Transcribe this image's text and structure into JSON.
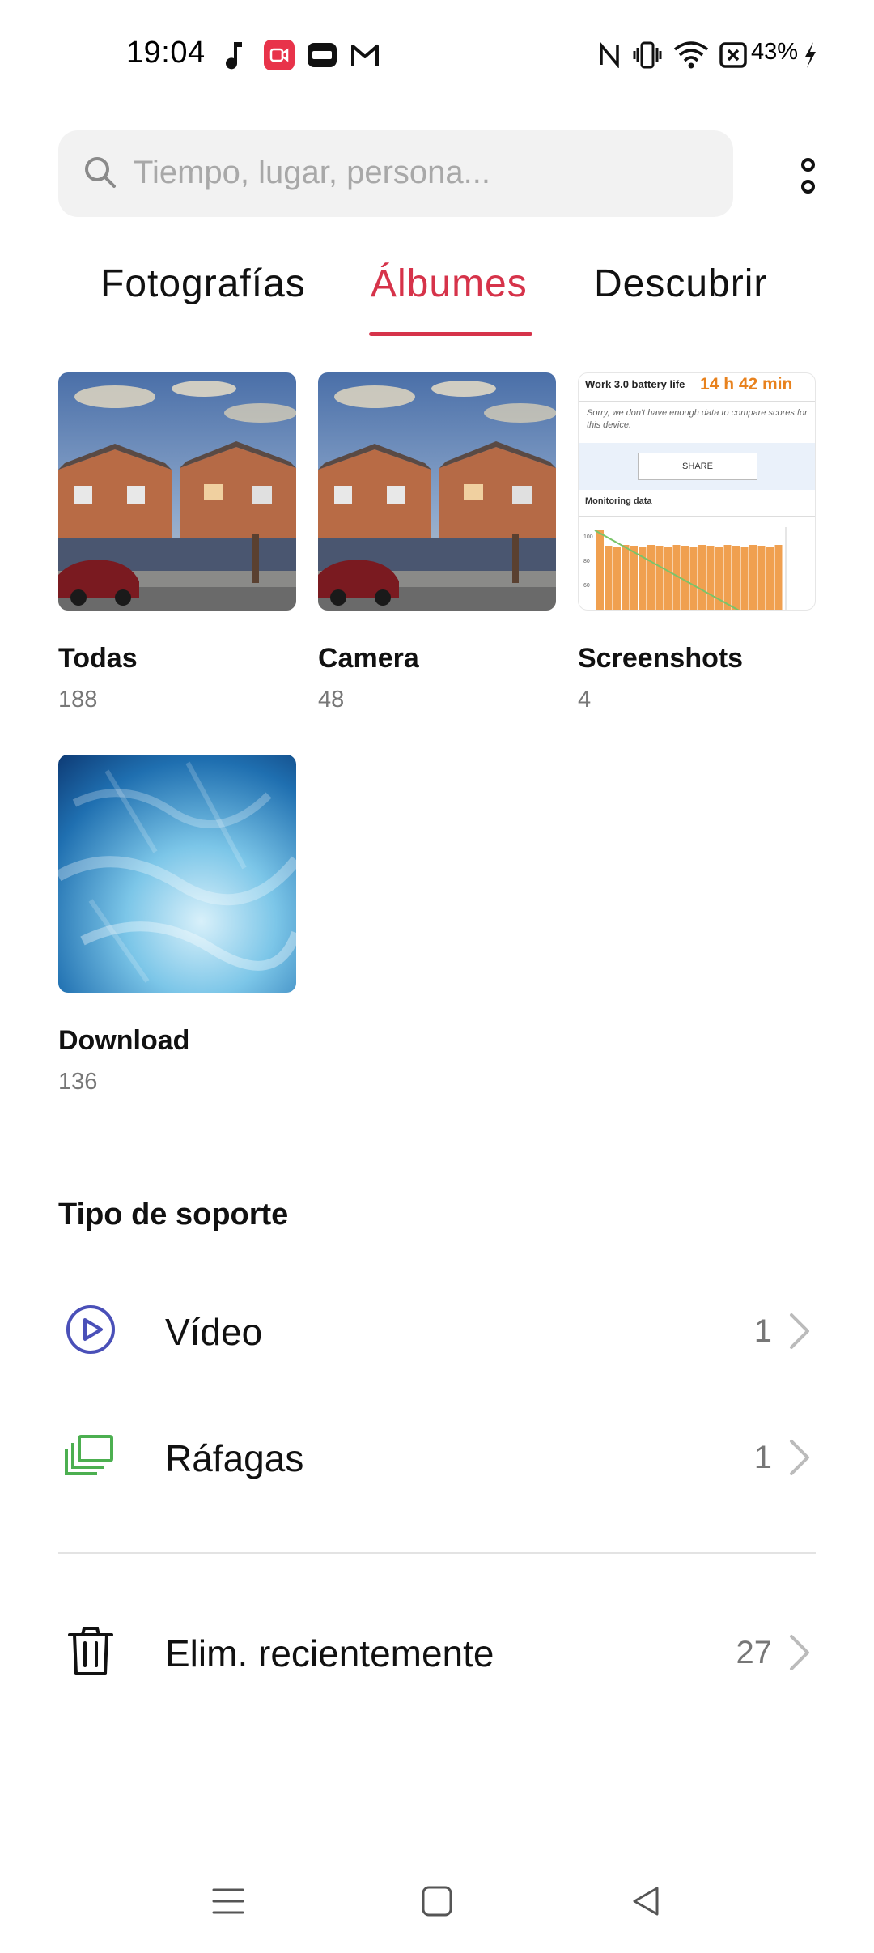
{
  "status_bar": {
    "time": "19:04",
    "battery_percent": "43%",
    "icons": [
      "music-note-icon",
      "screen-record-icon",
      "cast-icon",
      "gmail-icon",
      "nfc-icon",
      "vibrate-icon",
      "wifi-icon",
      "no-sim-icon",
      "charging-icon"
    ],
    "record_color": "#e8334a"
  },
  "search": {
    "placeholder": "Tiempo, lugar, persona..."
  },
  "tabs": [
    {
      "label": "Fotografías",
      "active": false
    },
    {
      "label": "Álbumes",
      "active": true
    },
    {
      "label": "Descubrir",
      "active": false
    }
  ],
  "accent_color": "#d6334a",
  "albums": [
    {
      "name": "Todas",
      "count": "188",
      "thumb": "houses-photo"
    },
    {
      "name": "Camera",
      "count": "48",
      "thumb": "houses-photo"
    },
    {
      "name": "Screenshots",
      "count": "4",
      "thumb": "battery-screenshot"
    },
    {
      "name": "Download",
      "count": "136",
      "thumb": "blue-wallpaper"
    }
  ],
  "screenshot_thumb": {
    "title": "Work 3.0 battery life",
    "value": "14 h 42 min",
    "note": "Sorry, we don't have enough data to compare scores for this device.",
    "share": "SHARE",
    "section": "Monitoring data",
    "y_ticks": [
      "100",
      "80",
      "60"
    ]
  },
  "media_types": {
    "title": "Tipo de soporte",
    "items": [
      {
        "label": "Vídeo",
        "count": "1",
        "icon": "play-circle-icon",
        "color": "#4a50b8"
      },
      {
        "label": "Ráfagas",
        "count": "1",
        "icon": "burst-stack-icon",
        "color": "#4caf50"
      }
    ]
  },
  "recently_deleted": {
    "label": "Elim. recientemente",
    "count": "27",
    "icon": "trash-icon"
  },
  "nav_bar": [
    "menu-icon",
    "home-icon",
    "back-icon"
  ]
}
